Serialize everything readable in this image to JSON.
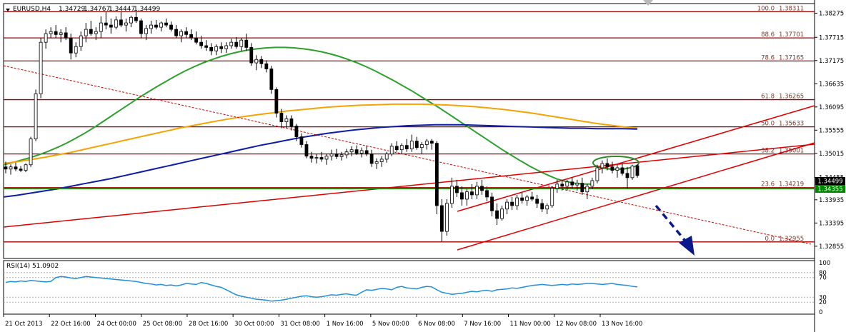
{
  "chart_data": {
    "type": "candlestick",
    "header": {
      "symbol": "EURUSD,H4",
      "open": "1.34729",
      "high": "1.34767",
      "low": "1.34447",
      "close": "1.34499"
    },
    "price_axis": {
      "ylim": [
        1.3257,
        1.385
      ],
      "ticks": [
        "1.38275",
        "1.37715",
        "1.37175",
        "1.36635",
        "1.36095",
        "1.35555",
        "1.35015",
        "1.34455",
        "1.33935",
        "1.33395",
        "1.32855"
      ],
      "current_price_label": "1.34499",
      "green_level_label": "1.34355"
    },
    "time_axis": {
      "labels": [
        "21 Oct 2013",
        "22 Oct 16:00",
        "24 Oct 00:00",
        "25 Oct 08:00",
        "28 Oct 16:00",
        "30 Oct 00:00",
        "31 Oct 08:00",
        "1 Nov 16:00",
        "5 Nov 00:00",
        "6 Nov 08:00",
        "7 Nov 16:00",
        "11 Nov 00:00",
        "12 Nov 08:00",
        "13 Nov 16:00"
      ]
    },
    "fibonacci": [
      {
        "ratio": "100.0",
        "price": "1.38311"
      },
      {
        "ratio": "88.6",
        "price": "1.37701"
      },
      {
        "ratio": "78.6",
        "price": "1.37165"
      },
      {
        "ratio": "61.8",
        "price": "1.36265"
      },
      {
        "ratio": "50.0",
        "price": "1.35633"
      },
      {
        "ratio": "38.2",
        "price": "1.35001"
      },
      {
        "ratio": "23.6",
        "price": "1.34219"
      },
      {
        "ratio": "0.0",
        "price": "1.32955"
      }
    ],
    "candles": [
      [
        1.347,
        1.3482,
        1.3455,
        1.3465
      ],
      [
        1.3465,
        1.3476,
        1.3452,
        1.347
      ],
      [
        1.347,
        1.348,
        1.346,
        1.3465
      ],
      [
        1.3465,
        1.3472,
        1.3458,
        1.3462
      ],
      [
        1.3462,
        1.3478,
        1.3458,
        1.3475
      ],
      [
        1.3475,
        1.354,
        1.347,
        1.3535
      ],
      [
        1.3535,
        1.365,
        1.353,
        1.364
      ],
      [
        1.364,
        1.377,
        1.363,
        1.376
      ],
      [
        1.376,
        1.379,
        1.3745,
        1.378
      ],
      [
        1.378,
        1.3795,
        1.377,
        1.3785
      ],
      [
        1.3785,
        1.38,
        1.377,
        1.3778
      ],
      [
        1.3778,
        1.379,
        1.376,
        1.3782
      ],
      [
        1.3782,
        1.3795,
        1.3765,
        1.377
      ],
      [
        1.377,
        1.378,
        1.372,
        1.3735
      ],
      [
        1.3735,
        1.376,
        1.3725,
        1.375
      ],
      [
        1.375,
        1.3785,
        1.374,
        1.3775
      ],
      [
        1.3775,
        1.3805,
        1.376,
        1.379
      ],
      [
        1.379,
        1.381,
        1.3775,
        1.378
      ],
      [
        1.378,
        1.3795,
        1.3765,
        1.3785
      ],
      [
        1.3785,
        1.382,
        1.377,
        1.3805
      ],
      [
        1.3805,
        1.383,
        1.379,
        1.38
      ],
      [
        1.38,
        1.3815,
        1.378,
        1.3795
      ],
      [
        1.3795,
        1.382,
        1.379,
        1.3812
      ],
      [
        1.3812,
        1.383,
        1.3795,
        1.38
      ],
      [
        1.38,
        1.3815,
        1.3785,
        1.3805
      ],
      [
        1.3805,
        1.3822,
        1.3795,
        1.3818
      ],
      [
        1.3818,
        1.3832,
        1.3805,
        1.381
      ],
      [
        1.381,
        1.3815,
        1.377,
        1.378
      ],
      [
        1.378,
        1.38,
        1.3765,
        1.3792
      ],
      [
        1.3792,
        1.381,
        1.378,
        1.38
      ],
      [
        1.38,
        1.3812,
        1.379,
        1.3795
      ],
      [
        1.3795,
        1.3808,
        1.3785,
        1.3805
      ],
      [
        1.3805,
        1.3815,
        1.3795,
        1.38
      ],
      [
        1.38,
        1.3808,
        1.3785,
        1.379
      ],
      [
        1.379,
        1.38,
        1.377,
        1.3775
      ],
      [
        1.3775,
        1.379,
        1.376,
        1.3785
      ],
      [
        1.3785,
        1.3795,
        1.377,
        1.3778
      ],
      [
        1.3778,
        1.379,
        1.3765,
        1.377
      ],
      [
        1.377,
        1.3785,
        1.3755,
        1.376
      ],
      [
        1.376,
        1.3775,
        1.3745,
        1.3752
      ],
      [
        1.3752,
        1.3765,
        1.374,
        1.3748
      ],
      [
        1.3748,
        1.3758,
        1.373,
        1.374
      ],
      [
        1.374,
        1.3755,
        1.373,
        1.375
      ],
      [
        1.375,
        1.376,
        1.3735,
        1.3745
      ],
      [
        1.3745,
        1.376,
        1.3735,
        1.3752
      ],
      [
        1.3752,
        1.3768,
        1.3745,
        1.376
      ],
      [
        1.376,
        1.3772,
        1.3745,
        1.375
      ],
      [
        1.375,
        1.377,
        1.374,
        1.3765
      ],
      [
        1.3765,
        1.378,
        1.374,
        1.3748
      ],
      [
        1.3748,
        1.3758,
        1.3705,
        1.3712
      ],
      [
        1.3712,
        1.373,
        1.3695,
        1.372
      ],
      [
        1.372,
        1.3728,
        1.37,
        1.371
      ],
      [
        1.371,
        1.3718,
        1.369,
        1.3698
      ],
      [
        1.3698,
        1.3705,
        1.364,
        1.365
      ],
      [
        1.365,
        1.3655,
        1.3585,
        1.3595
      ],
      [
        1.3595,
        1.3605,
        1.356,
        1.3575
      ],
      [
        1.3575,
        1.359,
        1.356,
        1.3582
      ],
      [
        1.3582,
        1.359,
        1.3555,
        1.3565
      ],
      [
        1.3565,
        1.357,
        1.353,
        1.354
      ],
      [
        1.354,
        1.3548,
        1.3515,
        1.3522
      ],
      [
        1.3522,
        1.353,
        1.349,
        1.3495
      ],
      [
        1.3495,
        1.3505,
        1.348,
        1.349
      ],
      [
        1.349,
        1.35,
        1.3478,
        1.3492
      ],
      [
        1.3492,
        1.3505,
        1.3482,
        1.3488
      ],
      [
        1.3488,
        1.35,
        1.3475,
        1.3495
      ],
      [
        1.3495,
        1.351,
        1.3485,
        1.35
      ],
      [
        1.35,
        1.3512,
        1.3488,
        1.3494
      ],
      [
        1.3494,
        1.3505,
        1.3485,
        1.3498
      ],
      [
        1.3498,
        1.3512,
        1.349,
        1.3505
      ],
      [
        1.3505,
        1.3518,
        1.3495,
        1.351
      ],
      [
        1.351,
        1.352,
        1.3498,
        1.3502
      ],
      [
        1.3502,
        1.3515,
        1.3492,
        1.3508
      ],
      [
        1.3508,
        1.352,
        1.3495,
        1.35
      ],
      [
        1.35,
        1.351,
        1.347,
        1.3478
      ],
      [
        1.3478,
        1.349,
        1.3465,
        1.3482
      ],
      [
        1.3482,
        1.3495,
        1.347,
        1.3488
      ],
      [
        1.3488,
        1.3505,
        1.348,
        1.35
      ],
      [
        1.35,
        1.3525,
        1.3495,
        1.3518
      ],
      [
        1.3518,
        1.353,
        1.3505,
        1.351
      ],
      [
        1.351,
        1.3525,
        1.35,
        1.352
      ],
      [
        1.352,
        1.3535,
        1.3505,
        1.3512
      ],
      [
        1.3512,
        1.3545,
        1.3505,
        1.353
      ],
      [
        1.353,
        1.354,
        1.351,
        1.3515
      ],
      [
        1.3515,
        1.3528,
        1.35,
        1.3522
      ],
      [
        1.3522,
        1.3535,
        1.351,
        1.353
      ],
      [
        1.353,
        1.3535,
        1.351,
        1.3525
      ],
      [
        1.3525,
        1.353,
        1.336,
        1.338
      ],
      [
        1.338,
        1.3395,
        1.3296,
        1.332
      ],
      [
        1.332,
        1.3395,
        1.331,
        1.3385
      ],
      [
        1.3385,
        1.3445,
        1.3375,
        1.3425
      ],
      [
        1.3425,
        1.344,
        1.34,
        1.341
      ],
      [
        1.341,
        1.3425,
        1.338,
        1.3395
      ],
      [
        1.3395,
        1.342,
        1.338,
        1.3412
      ],
      [
        1.3412,
        1.343,
        1.3395,
        1.3405
      ],
      [
        1.3405,
        1.3435,
        1.3395,
        1.3425
      ],
      [
        1.3425,
        1.344,
        1.3405,
        1.3415
      ],
      [
        1.3415,
        1.3425,
        1.339,
        1.34
      ],
      [
        1.34,
        1.341,
        1.3355,
        1.3368
      ],
      [
        1.3368,
        1.3385,
        1.3335,
        1.335
      ],
      [
        1.335,
        1.338,
        1.3345,
        1.3372
      ],
      [
        1.3372,
        1.3395,
        1.336,
        1.3388
      ],
      [
        1.3388,
        1.34,
        1.337,
        1.338
      ],
      [
        1.338,
        1.3405,
        1.337,
        1.3398
      ],
      [
        1.3398,
        1.341,
        1.3385,
        1.3392
      ],
      [
        1.3392,
        1.3405,
        1.338,
        1.34
      ],
      [
        1.34,
        1.3412,
        1.339,
        1.3395
      ],
      [
        1.3395,
        1.3405,
        1.3375,
        1.3385
      ],
      [
        1.3385,
        1.3395,
        1.3365,
        1.3372
      ],
      [
        1.3372,
        1.3385,
        1.336,
        1.338
      ],
      [
        1.338,
        1.3425,
        1.3375,
        1.342
      ],
      [
        1.342,
        1.344,
        1.341,
        1.343
      ],
      [
        1.343,
        1.344,
        1.3415,
        1.3425
      ],
      [
        1.3425,
        1.344,
        1.3415,
        1.3435
      ],
      [
        1.3435,
        1.3445,
        1.342,
        1.3428
      ],
      [
        1.3428,
        1.344,
        1.3415,
        1.3432
      ],
      [
        1.3432,
        1.3445,
        1.3405,
        1.3412
      ],
      [
        1.3412,
        1.343,
        1.3395,
        1.3425
      ],
      [
        1.3425,
        1.3445,
        1.3418,
        1.3438
      ],
      [
        1.3438,
        1.3475,
        1.3432,
        1.3468
      ],
      [
        1.3468,
        1.3485,
        1.3455,
        1.3478
      ],
      [
        1.3478,
        1.349,
        1.3462,
        1.347
      ],
      [
        1.347,
        1.3482,
        1.3455,
        1.3462
      ],
      [
        1.3462,
        1.3475,
        1.3445,
        1.3468
      ],
      [
        1.3468,
        1.3478,
        1.345,
        1.3455
      ],
      [
        1.3455,
        1.347,
        1.342,
        1.3445
      ],
      [
        1.3445,
        1.3475,
        1.344,
        1.3472
      ],
      [
        1.3473,
        1.3477,
        1.3445,
        1.345
      ]
    ],
    "moving_averages": [
      {
        "color": "#2ca02c",
        "values": [
          1.3475,
          1.348,
          1.3486,
          1.3492,
          1.3499,
          1.3507,
          1.3516,
          1.3526,
          1.3537,
          1.3549,
          1.3562,
          1.3576,
          1.359,
          1.3604,
          1.3618,
          1.3632,
          1.3645,
          1.3658,
          1.367,
          1.3682,
          1.3693,
          1.3703,
          1.3712,
          1.372,
          1.3727,
          1.3733,
          1.3738,
          1.3742,
          1.3745,
          1.3747,
          1.3748,
          1.3748,
          1.3747,
          1.3745,
          1.3742,
          1.3738,
          1.3733,
          1.3727,
          1.372,
          1.3712,
          1.3703,
          1.3693,
          1.3682,
          1.3671,
          1.3659,
          1.3647,
          1.3634,
          1.3621,
          1.3608,
          1.3594,
          1.358,
          1.3566,
          1.3552,
          1.3538,
          1.3524,
          1.351,
          1.3497,
          1.3484,
          1.3472,
          1.3461,
          1.3451,
          1.3442,
          1.3436,
          1.3432,
          1.343,
          1.343
        ]
      },
      {
        "color": "#f5a300",
        "values": [
          1.3478,
          1.3482,
          1.3487,
          1.3492,
          1.3498,
          1.3504,
          1.3511,
          1.3518,
          1.3525,
          1.3532,
          1.3539,
          1.3546,
          1.3553,
          1.356,
          1.3566,
          1.3572,
          1.3578,
          1.3583,
          1.3588,
          1.3592,
          1.3596,
          1.36,
          1.3603,
          1.3606,
          1.3609,
          1.3611,
          1.3613,
          1.3614,
          1.3615,
          1.3616,
          1.3616,
          1.3616,
          1.3615,
          1.3614,
          1.3612,
          1.361,
          1.3607,
          1.3604,
          1.36,
          1.3596,
          1.3591,
          1.3586,
          1.3581,
          1.3576,
          1.3571,
          1.3567,
          1.3563,
          1.356
        ]
      },
      {
        "color": "#0d1ca8",
        "values": [
          1.34,
          1.3404,
          1.3409,
          1.3414,
          1.3419,
          1.3425,
          1.3431,
          1.3437,
          1.3443,
          1.345,
          1.3457,
          1.3464,
          1.3471,
          1.3478,
          1.3485,
          1.3492,
          1.3499,
          1.3506,
          1.3513,
          1.352,
          1.3526,
          1.3532,
          1.3538,
          1.3543,
          1.3548,
          1.3552,
          1.3556,
          1.3559,
          1.3562,
          1.3564,
          1.3566,
          1.3567,
          1.3568,
          1.3568,
          1.3568,
          1.3567,
          1.3566,
          1.3565,
          1.3564,
          1.3563,
          1.3562,
          1.3561,
          1.356,
          1.356,
          1.3559,
          1.3559,
          1.3559,
          1.3558
        ]
      }
    ],
    "rsi": {
      "label": "RSI(14) 51.0902",
      "levels": [
        "100",
        "80",
        "70",
        "30",
        "20",
        "0"
      ],
      "values": [
        60,
        62,
        61,
        63,
        62,
        64,
        63,
        62,
        61,
        62,
        70,
        72,
        71,
        69,
        68,
        70,
        72,
        71,
        70,
        69,
        68,
        67,
        66,
        65,
        64,
        63,
        62,
        60,
        58,
        57,
        55,
        56,
        54,
        55,
        53,
        55,
        58,
        57,
        56,
        60,
        58,
        55,
        52,
        50,
        45,
        40,
        35,
        32,
        30,
        28,
        26,
        25,
        24,
        22,
        23,
        24,
        26,
        28,
        30,
        32,
        33,
        31,
        30,
        31,
        33,
        35,
        34,
        36,
        37,
        35,
        34,
        40,
        45,
        44,
        46,
        48,
        47,
        45,
        50,
        52,
        49,
        48,
        47,
        50,
        52,
        51,
        45,
        40,
        38,
        36,
        37,
        38,
        40,
        42,
        41,
        43,
        44,
        42,
        45,
        46,
        47,
        49,
        48,
        50,
        52,
        54,
        55,
        56,
        55,
        54,
        55,
        56,
        55,
        57,
        56,
        57,
        58,
        58,
        57,
        56,
        57,
        58,
        56,
        55,
        54,
        52,
        51
      ]
    },
    "annotations": {
      "forecast_arrow": "down"
    }
  }
}
